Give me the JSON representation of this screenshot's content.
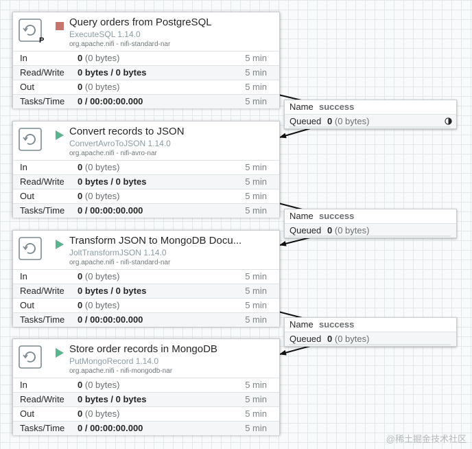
{
  "processors": [
    {
      "name": "Query orders from PostgreSQL",
      "type": "ExecuteSQL 1.14.0",
      "bundle": "org.apache.nifi - nifi-standard-nar",
      "status": "stopped",
      "primary_badge": "P",
      "in": {
        "label": "In",
        "count": "0",
        "detail": "(0 bytes)",
        "window": "5 min"
      },
      "readwrite": {
        "label": "Read/Write",
        "value": "0 bytes / 0 bytes",
        "window": "5 min"
      },
      "out": {
        "label": "Out",
        "count": "0",
        "detail": "(0 bytes)",
        "window": "5 min"
      },
      "tasks": {
        "label": "Tasks/Time",
        "value": "0 / 00:00:00.000",
        "window": "5 min"
      }
    },
    {
      "name": "Convert records to JSON",
      "type": "ConvertAvroToJSON 1.14.0",
      "bundle": "org.apache.nifi - nifi-avro-nar",
      "status": "running",
      "primary_badge": "",
      "in": {
        "label": "In",
        "count": "0",
        "detail": "(0 bytes)",
        "window": "5 min"
      },
      "readwrite": {
        "label": "Read/Write",
        "value": "0 bytes / 0 bytes",
        "window": "5 min"
      },
      "out": {
        "label": "Out",
        "count": "0",
        "detail": "(0 bytes)",
        "window": "5 min"
      },
      "tasks": {
        "label": "Tasks/Time",
        "value": "0 / 00:00:00.000",
        "window": "5 min"
      }
    },
    {
      "name": "Transform JSON to MongoDB Docu...",
      "type": "JoltTransformJSON 1.14.0",
      "bundle": "org.apache.nifi - nifi-standard-nar",
      "status": "running",
      "primary_badge": "",
      "in": {
        "label": "In",
        "count": "0",
        "detail": "(0 bytes)",
        "window": "5 min"
      },
      "readwrite": {
        "label": "Read/Write",
        "value": "0 bytes / 0 bytes",
        "window": "5 min"
      },
      "out": {
        "label": "Out",
        "count": "0",
        "detail": "(0 bytes)",
        "window": "5 min"
      },
      "tasks": {
        "label": "Tasks/Time",
        "value": "0 / 00:00:00.000",
        "window": "5 min"
      }
    },
    {
      "name": "Store order records in MongoDB",
      "type": "PutMongoRecord 1.14.0",
      "bundle": "org.apache.nifi - nifi-mongodb-nar",
      "status": "running",
      "primary_badge": "",
      "in": {
        "label": "In",
        "count": "0",
        "detail": "(0 bytes)",
        "window": "5 min"
      },
      "readwrite": {
        "label": "Read/Write",
        "value": "0 bytes / 0 bytes",
        "window": "5 min"
      },
      "out": {
        "label": "Out",
        "count": "0",
        "detail": "(0 bytes)",
        "window": "5 min"
      },
      "tasks": {
        "label": "Tasks/Time",
        "value": "0 / 00:00:00.000",
        "window": "5 min"
      }
    }
  ],
  "connections": [
    {
      "name_label": "Name",
      "name": "success",
      "queued_label": "Queued",
      "queued_count": "0",
      "queued_detail": "(0 bytes)",
      "load_icon": "load-balance-icon"
    },
    {
      "name_label": "Name",
      "name": "success",
      "queued_label": "Queued",
      "queued_count": "0",
      "queued_detail": "(0 bytes)",
      "load_icon": ""
    },
    {
      "name_label": "Name",
      "name": "success",
      "queued_label": "Queued",
      "queued_count": "0",
      "queued_detail": "(0 bytes)",
      "load_icon": ""
    }
  ],
  "watermark": "@稀土掘金技术社区",
  "colors": {
    "stopped": "#c7766f",
    "running": "#5ab58f",
    "type_text": "#8a9ca4",
    "grid": "#e3e8eb"
  }
}
